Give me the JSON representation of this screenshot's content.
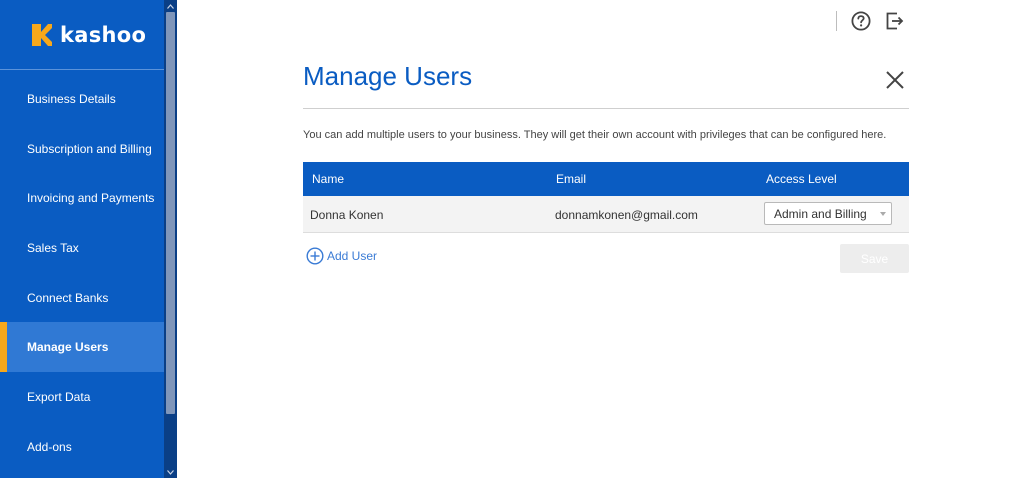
{
  "brand": {
    "name": "kashoo",
    "accent": "#f7a81b",
    "primary": "#0a5cc2"
  },
  "sidebar": {
    "items": [
      {
        "label": "Business Details"
      },
      {
        "label": "Subscription and Billing"
      },
      {
        "label": "Invoicing and Payments"
      },
      {
        "label": "Sales Tax"
      },
      {
        "label": "Connect Banks"
      },
      {
        "label": "Manage Users",
        "active": true
      },
      {
        "label": "Export Data"
      },
      {
        "label": "Add-ons"
      }
    ]
  },
  "topbar": {
    "icons": [
      "help-circle-icon",
      "logout-icon"
    ]
  },
  "main": {
    "title": "Manage Users",
    "description": "You can add multiple users to your business. They will get their own account with privileges that can be configured here.",
    "table": {
      "headers": {
        "name": "Name",
        "email": "Email",
        "access": "Access Level"
      },
      "rows": [
        {
          "name": "Donna Konen",
          "email": "donnamkonen@gmail.com",
          "access": "Admin and Billing"
        }
      ]
    },
    "add_user_label": "Add User",
    "save_label": "Save"
  }
}
